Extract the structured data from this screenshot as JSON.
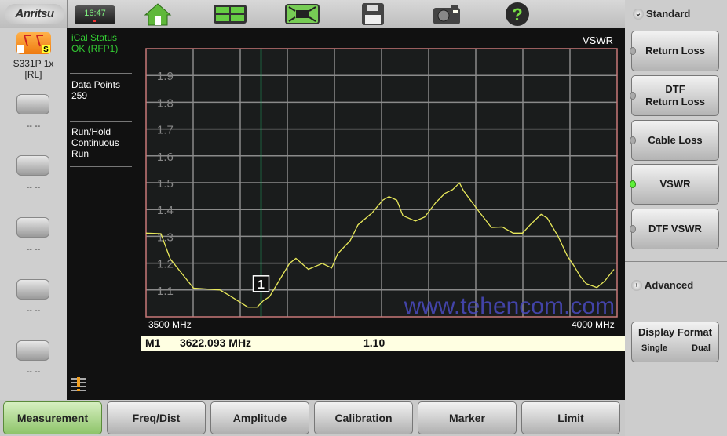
{
  "brand": "Anritsu",
  "clock": "16:47",
  "toolbar_icons": [
    "home-icon",
    "layout-icon",
    "fullscreen-icon",
    "save-icon",
    "camera-icon",
    "help-icon"
  ],
  "instrument": {
    "model": "S331P 1x",
    "mode": "[RL]"
  },
  "softkeys": [
    {
      "label": "-- --"
    },
    {
      "label": "-- --"
    },
    {
      "label": "-- --"
    },
    {
      "label": "-- --"
    },
    {
      "label": "-- --"
    }
  ],
  "info": {
    "ical_line1": "iCal Status",
    "ical_line2": "OK (RFP1)",
    "dp_label": "Data Points",
    "dp_value": "259",
    "run_line1": "Run/Hold",
    "run_line2": "Continuous",
    "run_line3": "Run"
  },
  "colors": {
    "ical": "#33cc33",
    "trace": "#e8e85a",
    "marker_line": "#1fa060",
    "frame": "#c87878",
    "led_on": "#5ef03a",
    "watermark": "#4a4ac0"
  },
  "watermark": "www.tehencom.com",
  "chart_data": {
    "type": "line",
    "title": "VSWR",
    "xlabel": "",
    "ylabel": "",
    "x_start_label": "3500 MHz",
    "x_stop_label": "4000 MHz",
    "xlim": [
      3500,
      4000
    ],
    "ylim": [
      1.0,
      2.0
    ],
    "yticks": [
      "1.9",
      "1.8",
      "1.7",
      "1.6",
      "1.5",
      "1.4",
      "1.3",
      "1.2",
      "1.1"
    ],
    "grid": true,
    "x": [
      3500,
      3515.8,
      3525.7,
      3542.2,
      3550.4,
      3578.4,
      3588.3,
      3608,
      3617.9,
      3624.5,
      3631.1,
      3641,
      3652.5,
      3659.1,
      3672.3,
      3687.1,
      3697,
      3703.6,
      3716.7,
      3725,
      3739.8,
      3751.3,
      3757.9,
      3766.2,
      3772.7,
      3785.9,
      3795.8,
      3807.3,
      3817.2,
      3825.5,
      3832.7,
      3837,
      3851.8,
      3866.6,
      3878.1,
      3889.7,
      3899.6,
      3907.8,
      3919.3,
      3925.9,
      3937.4,
      3947.3,
      3953.9,
      3960.5,
      3967.1,
      3978.6,
      3986.8,
      3996.7
    ],
    "y": [
      1.312,
      1.31,
      1.216,
      1.143,
      1.107,
      1.1,
      1.08,
      1.036,
      1.036,
      1.06,
      1.075,
      1.133,
      1.2,
      1.218,
      1.177,
      1.199,
      1.182,
      1.236,
      1.284,
      1.343,
      1.387,
      1.435,
      1.448,
      1.435,
      1.377,
      1.357,
      1.372,
      1.425,
      1.46,
      1.474,
      1.499,
      1.47,
      1.4,
      1.333,
      1.335,
      1.312,
      1.312,
      1.343,
      1.382,
      1.368,
      1.3,
      1.226,
      1.192,
      1.153,
      1.124,
      1.109,
      1.133,
      1.177
    ],
    "marker": {
      "id": "M1",
      "number": "1",
      "freq": 3622.093,
      "freq_label": "3622.093 MHz",
      "value_label": "1.10"
    }
  },
  "right_panel": {
    "section1": "Standard",
    "buttons": [
      {
        "label": "Return Loss",
        "active": false
      },
      {
        "label": "DTF\nReturn Loss",
        "active": false
      },
      {
        "label": "Cable Loss",
        "active": false
      },
      {
        "label": "VSWR",
        "active": true
      },
      {
        "label": "DTF VSWR",
        "active": false
      }
    ],
    "section2": "Advanced",
    "display_format": {
      "label": "Display Format",
      "single": "Single",
      "dual": "Dual",
      "selected": "Single"
    }
  },
  "tabs": [
    {
      "label": "Measurement",
      "active": true
    },
    {
      "label": "Freq/Dist"
    },
    {
      "label": "Amplitude"
    },
    {
      "label": "Calibration"
    },
    {
      "label": "Marker"
    },
    {
      "label": "Limit"
    }
  ]
}
